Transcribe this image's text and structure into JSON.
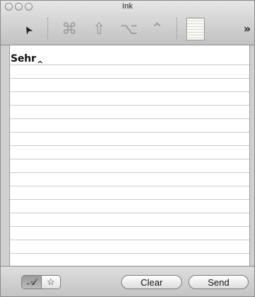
{
  "window": {
    "title": "Ink"
  },
  "toolbar": {
    "items": [
      {
        "name": "pointer-icon",
        "glyph": "➤"
      },
      {
        "name": "command-key-icon",
        "glyph": "⌘"
      },
      {
        "name": "shift-key-icon",
        "glyph": "⇧"
      },
      {
        "name": "option-key-icon",
        "glyph": "⌥"
      },
      {
        "name": "control-key-icon",
        "glyph": "⌃"
      },
      {
        "name": "notepad-icon",
        "glyph": ""
      },
      {
        "name": "more-icon",
        "glyph": "»"
      }
    ]
  },
  "paper": {
    "ink_text": "Sehr",
    "caret": "^"
  },
  "bottom": {
    "mode_script_glyph": "𝒜",
    "mode_star_glyph": "☆",
    "clear_label": "Clear",
    "send_label": "Send"
  }
}
